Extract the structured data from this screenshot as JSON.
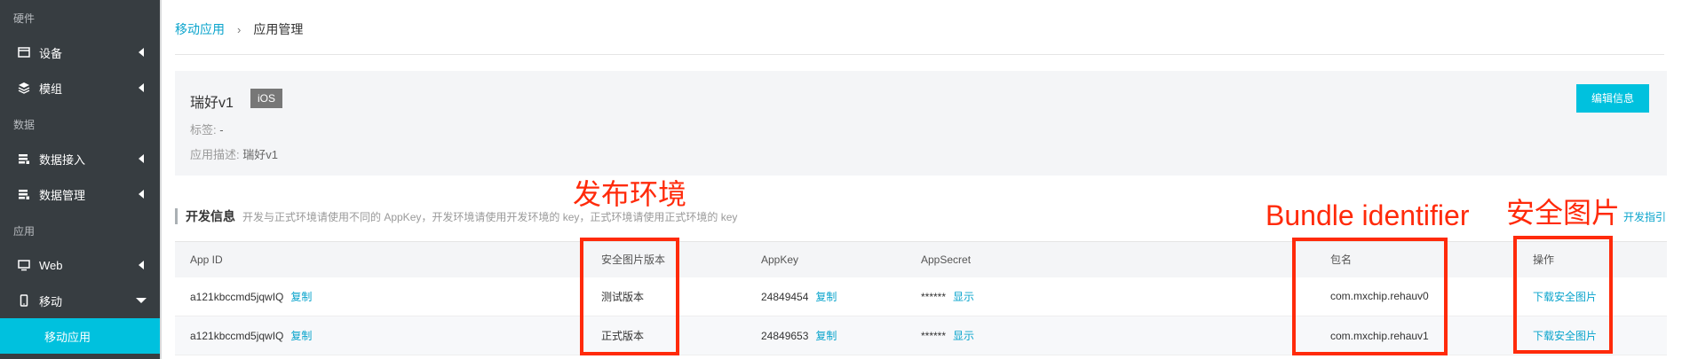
{
  "sidebar": {
    "sections": [
      {
        "title": "硬件"
      },
      {
        "title": "数据"
      },
      {
        "title": "应用"
      }
    ],
    "items": [
      {
        "label": "设备",
        "icon": "device-icon"
      },
      {
        "label": "模组",
        "icon": "module-icon"
      },
      {
        "label": "数据接入",
        "icon": "data-access-icon"
      },
      {
        "label": "数据管理",
        "icon": "data-manage-icon"
      },
      {
        "label": "Web",
        "icon": "monitor-icon"
      },
      {
        "label": "移动",
        "icon": "mobile-icon"
      }
    ],
    "active_sub": "移动应用"
  },
  "breadcrumb": {
    "parent": "移动应用",
    "separator": "›",
    "current": "应用管理"
  },
  "app": {
    "name": "瑞好v1",
    "platform": "iOS",
    "tag_label": "标签:",
    "tag_value": "-",
    "desc_label": "应用描述:",
    "desc_value": "瑞好v1",
    "edit_label": "编辑信息"
  },
  "dev": {
    "title": "开发信息",
    "desc": "开发与正式环境请使用不同的 AppKey，开发环境请使用开发环境的 key，正式环境请使用正式环境的 key",
    "guide": "开发指引"
  },
  "table": {
    "headers": [
      "App ID",
      "安全图片版本",
      "AppKey",
      "AppSecret",
      "包名",
      "操作"
    ],
    "rows": [
      {
        "app_id": "a121kbccmd5jqwIQ",
        "copy": "复制",
        "version": "测试版本",
        "appkey": "24849454",
        "key_copy": "复制",
        "secret": "******",
        "show": "显示",
        "package": "com.mxchip.rehauv0",
        "action": "下载安全图片"
      },
      {
        "app_id": "a121kbccmd5jqwIQ",
        "copy": "复制",
        "version": "正式版本",
        "appkey": "24849653",
        "key_copy": "复制",
        "secret": "******",
        "show": "显示",
        "package": "com.mxchip.rehauv1",
        "action": "下载安全图片"
      }
    ]
  },
  "annotations": {
    "env": "发布环境",
    "bundle": "Bundle identifier",
    "image": "安全图片",
    "color": "#ff2a0a"
  },
  "colors": {
    "accent": "#00c1de",
    "sidebar": "#373d41",
    "link": "#0aa4cc"
  }
}
